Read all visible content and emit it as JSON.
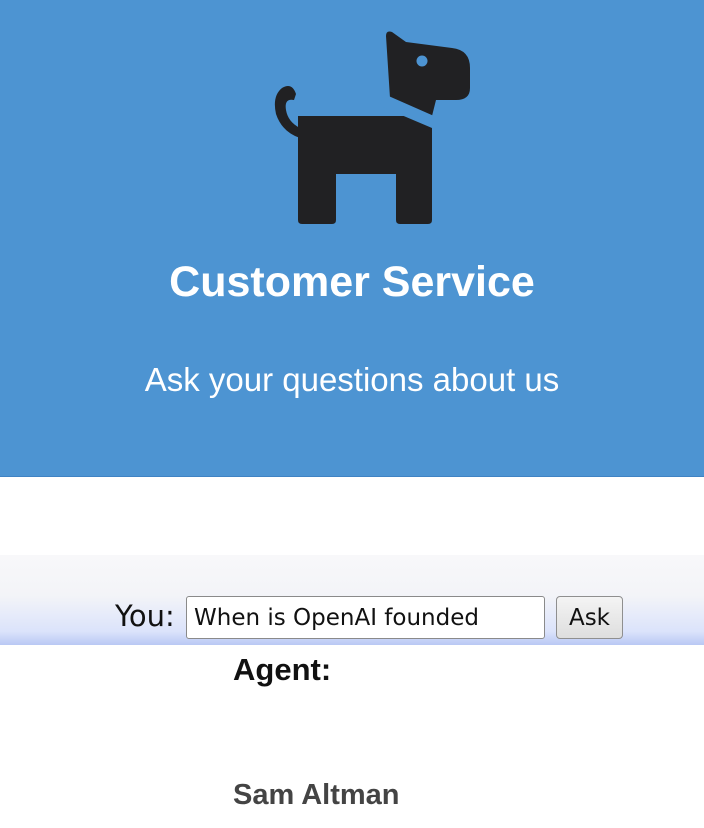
{
  "header": {
    "icon": "dog-icon",
    "title": "Customer Service",
    "subtitle": "Ask your questions about us",
    "background_color": "#4d94d2"
  },
  "chat": {
    "you_label": "You:",
    "question_value": "When is OpenAI founded",
    "ask_button_label": "Ask",
    "agent_label": "Agent:",
    "agent_answer": "Sam Altman"
  }
}
